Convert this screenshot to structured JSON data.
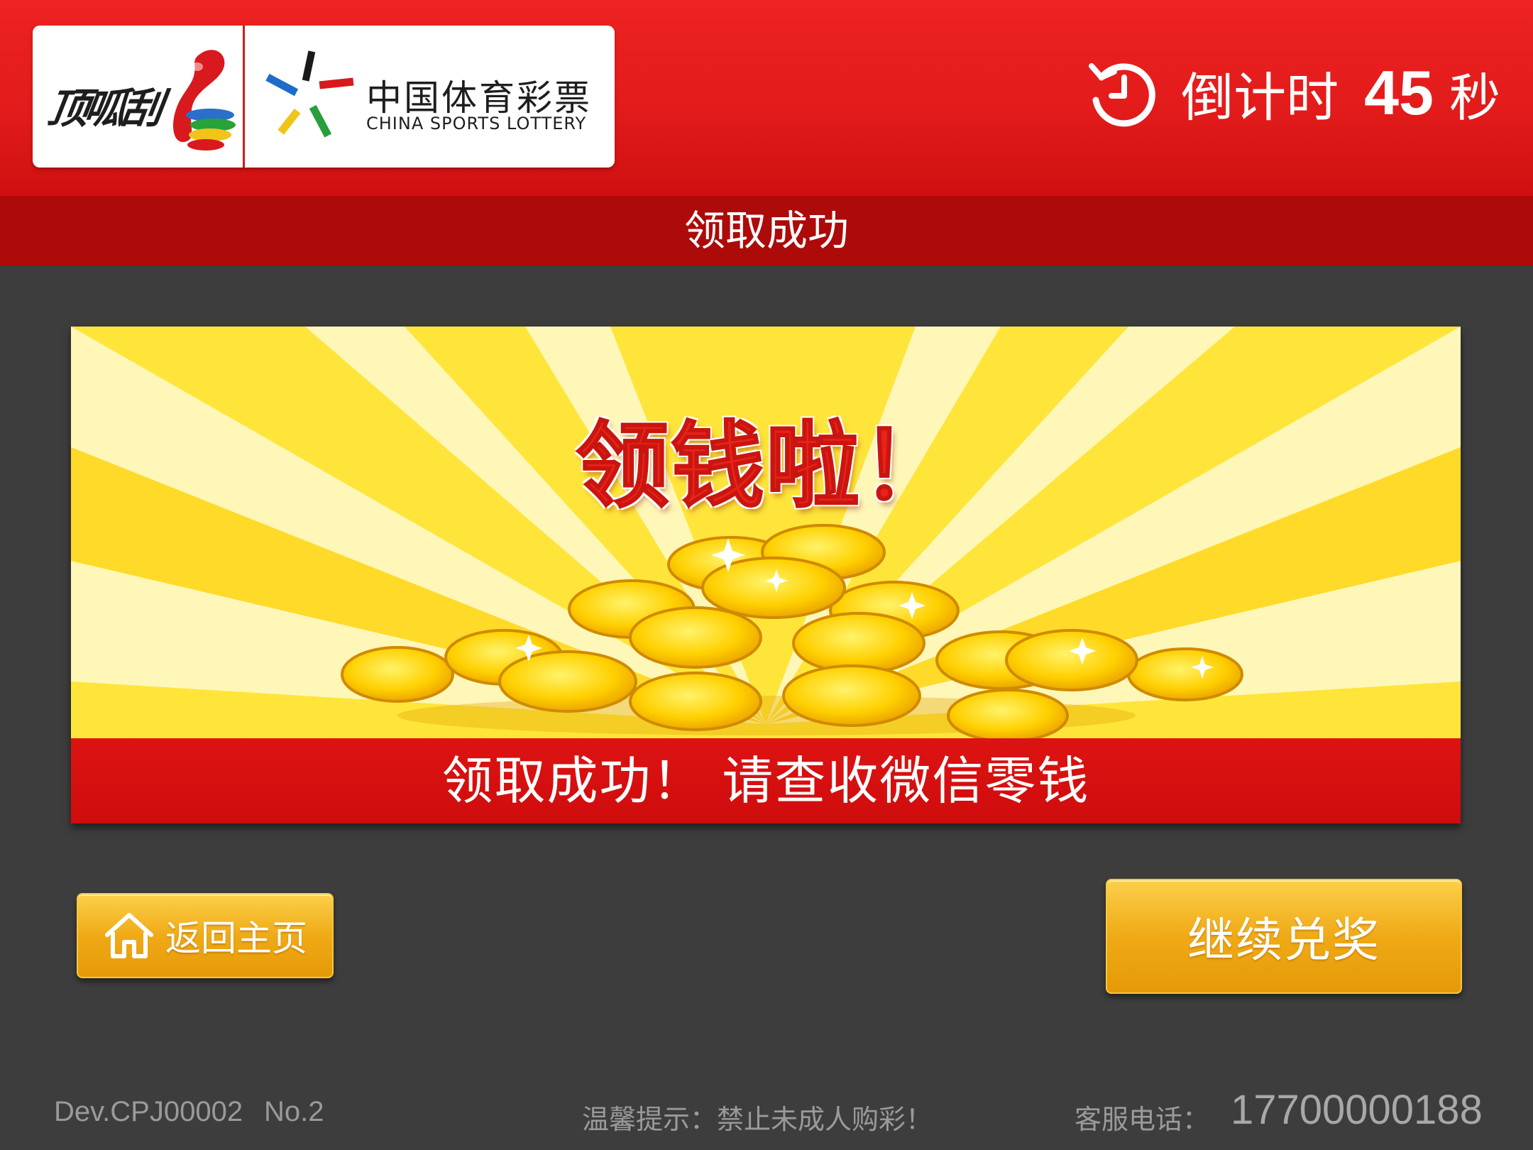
{
  "header": {
    "brand_name": "顶呱刮",
    "lottery_name_cn": "中国体育彩票",
    "lottery_name_en": "CHINA SPORTS LOTTERY",
    "timer_label": "倒计时",
    "timer_value": "45",
    "timer_unit": "秒"
  },
  "titlebar": {
    "title": "领取成功"
  },
  "banner": {
    "headline": "领钱啦！",
    "message": "领取成功！ 请查收微信零钱"
  },
  "buttons": {
    "home_label": "返回主页",
    "continue_label": "继续兑奖"
  },
  "footer": {
    "device_id": "Dev.CPJ00002",
    "device_no": "No.2",
    "tip": "温馨提示：禁止未成人购彩！",
    "hotline_label": "客服电话：",
    "hotline_number": "17700000188"
  },
  "colors": {
    "header_red": "#e31b1b",
    "titlebar_red": "#ad0a0a",
    "background": "#3d3d3d",
    "button_gold": "#f0aa16",
    "banner_yellow": "#ffe033",
    "headline_red": "#e8231a"
  },
  "icons": {
    "timer": "countdown-clock-icon",
    "home": "home-icon",
    "brand": "brand-logo",
    "lottery": "china-sports-lottery-mark"
  }
}
